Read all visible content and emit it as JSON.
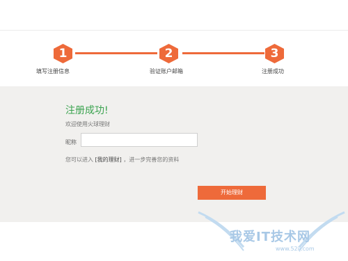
{
  "steps": [
    {
      "number": "1",
      "label": "填写注册信息"
    },
    {
      "number": "2",
      "label": "验证账户邮箱"
    },
    {
      "number": "3",
      "label": "注册成功"
    }
  ],
  "panel": {
    "title": "注册成功!",
    "welcome": "欢迎使用火球理财",
    "nickname_label": "昵称",
    "nickname_value": "",
    "hint_prefix": "您可以进入 ",
    "hint_link": "[我的理财]",
    "hint_suffix": " ，进一步完善您的资料",
    "start_button": "开始理财"
  },
  "watermark": {
    "text": "我爱IT技术网",
    "url": "www.52ij.com"
  },
  "colors": {
    "accent": "#ee6a3a",
    "success": "#3aa34f",
    "panel_bg": "#f1f0ee"
  }
}
